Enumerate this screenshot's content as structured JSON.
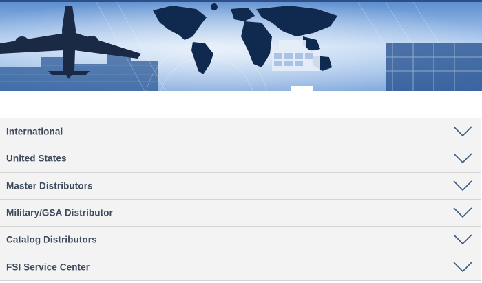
{
  "banner": {
    "icon": "world-logistics-banner"
  },
  "accordion": {
    "items": [
      {
        "label": "International"
      },
      {
        "label": "United States"
      },
      {
        "label": "Master Distributors"
      },
      {
        "label": "Military/GSA Distributor"
      },
      {
        "label": "Catalog Distributors"
      },
      {
        "label": "FSI Service Center"
      }
    ]
  },
  "colors": {
    "accent": "#2e4f87",
    "label": "#3d4a5c",
    "row_bg": "#f3f3f3"
  }
}
